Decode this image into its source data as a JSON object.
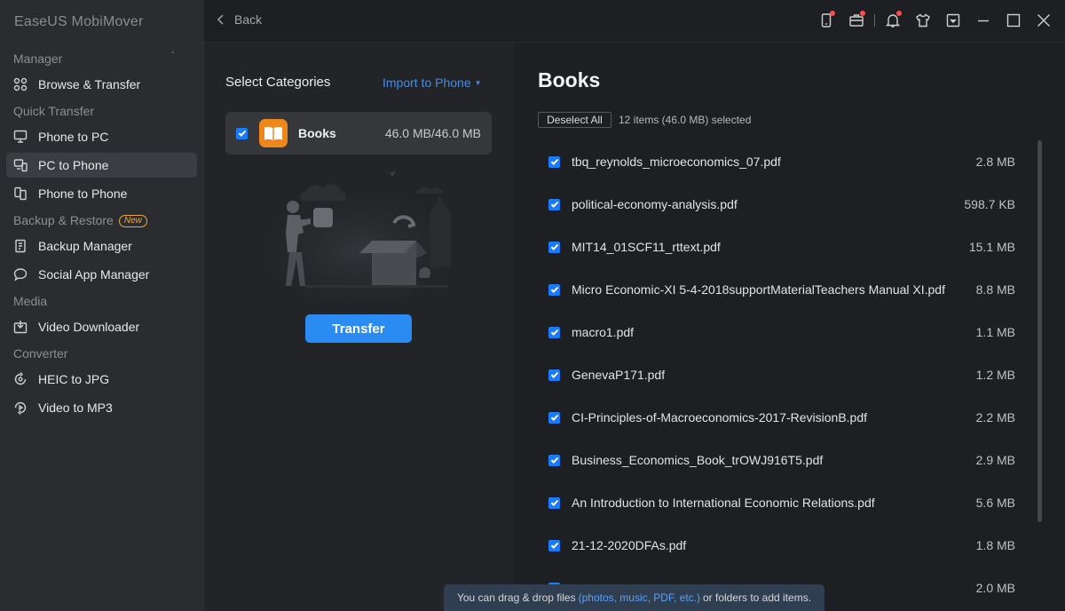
{
  "app": {
    "title": "EaseUS MobiMover"
  },
  "sidebar": {
    "sections": [
      {
        "label": "Manager",
        "items": [
          {
            "label": "Browse & Transfer",
            "icon": "grid-icon"
          }
        ]
      },
      {
        "label": "Quick Transfer",
        "items": [
          {
            "label": "Phone to PC",
            "icon": "phone-to-pc-icon"
          },
          {
            "label": "PC to Phone",
            "icon": "pc-to-phone-icon",
            "active": true
          },
          {
            "label": "Phone to Phone",
            "icon": "phone-to-phone-icon"
          }
        ]
      },
      {
        "label": "Backup & Restore",
        "badge": "New",
        "items": [
          {
            "label": "Backup Manager",
            "icon": "backup-icon"
          },
          {
            "label": "Social App Manager",
            "icon": "chat-icon"
          }
        ]
      },
      {
        "label": "Media",
        "items": [
          {
            "label": "Video Downloader",
            "icon": "download-icon"
          }
        ]
      },
      {
        "label": "Converter",
        "items": [
          {
            "label": "HEIC to JPG",
            "icon": "convert-image-icon"
          },
          {
            "label": "Video to MP3",
            "icon": "convert-audio-icon"
          }
        ]
      }
    ]
  },
  "topbar": {
    "back_label": "Back"
  },
  "left": {
    "select_categories": "Select Categories",
    "import_label": "Import to Phone",
    "category": {
      "name": "Books",
      "size": "46.0 MB/46.0 MB"
    },
    "transfer_label": "Transfer"
  },
  "main": {
    "title": "Books",
    "deselect_label": "Deselect All",
    "summary": "12 items (46.0 MB) selected",
    "files": [
      {
        "name": "tbq_reynolds_microeconomics_07.pdf",
        "size": "2.8 MB"
      },
      {
        "name": "political-economy-analysis.pdf",
        "size": "598.7 KB"
      },
      {
        "name": "MIT14_01SCF11_rttext.pdf",
        "size": "15.1 MB"
      },
      {
        "name": "Micro Economic-XI 5-4-2018supportMaterialTeachers Manual XI.pdf",
        "size": "8.8 MB"
      },
      {
        "name": "macro1.pdf",
        "size": "1.1 MB"
      },
      {
        "name": "GenevaP171.pdf",
        "size": "1.2 MB"
      },
      {
        "name": "CI-Principles-of-Macroeconomics-2017-RevisionB.pdf",
        "size": "2.2 MB"
      },
      {
        "name": "Business_Economics_Book_trOWJ916T5.pdf",
        "size": "2.9 MB"
      },
      {
        "name": "An Introduction to International Economic Relations.pdf",
        "size": "5.6 MB"
      },
      {
        "name": "21-12-2020DFAs.pdf",
        "size": "1.8 MB"
      },
      {
        "name": "",
        "size": "2.0 MB"
      }
    ]
  },
  "hint": {
    "pre": "You can drag & drop files",
    "highlight": "(photos, music, PDF, etc.)",
    "post": "or folders to add items."
  },
  "colors": {
    "accent": "#2a8bf2",
    "link": "#3d8cf0",
    "badge": "#f0a640",
    "books_icon": "#f0871b"
  }
}
